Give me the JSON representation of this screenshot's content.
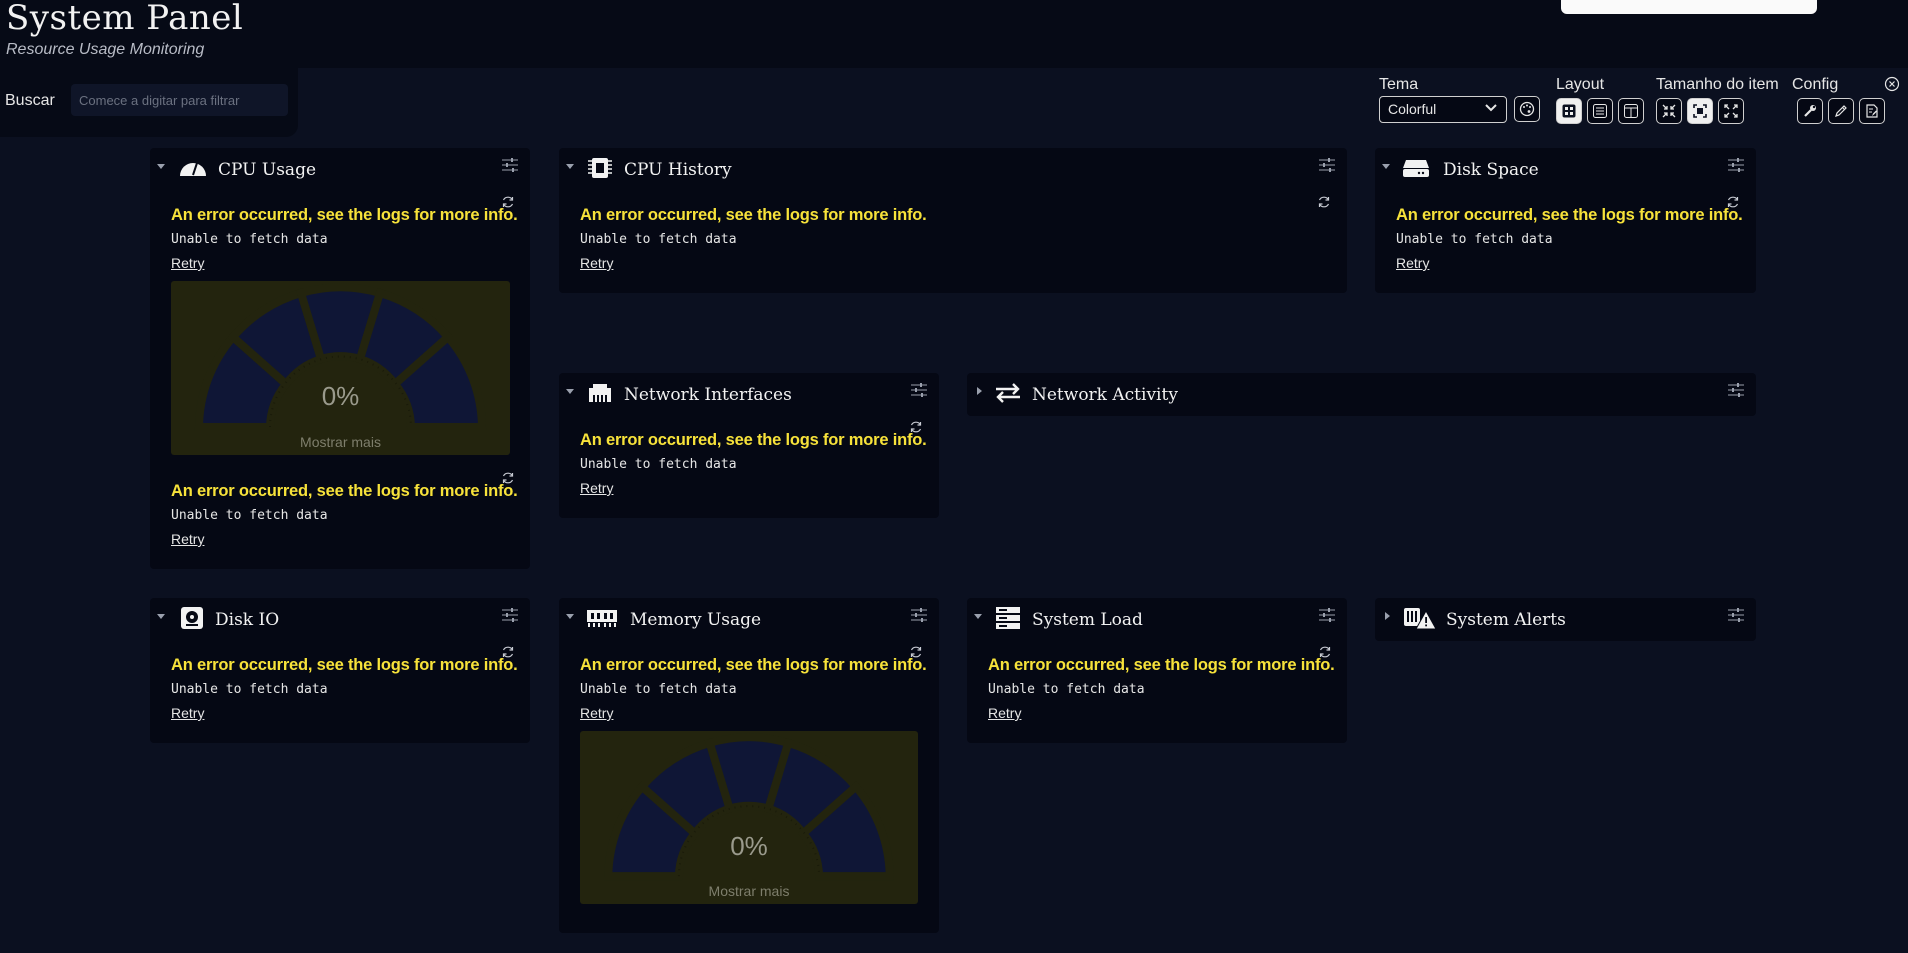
{
  "header": {
    "title": "System Panel",
    "subtitle": "Resource Usage Monitoring"
  },
  "search": {
    "label": "Buscar",
    "placeholder": "Comece a digitar para filtrar"
  },
  "settings": {
    "theme_label": "Tema",
    "theme_value": "Colorful",
    "layout_label": "Layout",
    "item_size_label": "Tamanho do item",
    "config_label": "Config"
  },
  "error": {
    "title": "An error occurred, see the logs for more info.",
    "message": "Unable to fetch data",
    "retry": "Retry"
  },
  "gauge": {
    "value": "0%",
    "more": "Mostrar mais"
  },
  "cards": {
    "cpu_usage": {
      "title": "CPU Usage",
      "icon": "gauge-icon"
    },
    "cpu_history": {
      "title": "CPU History",
      "icon": "cpu-chip-icon"
    },
    "disk_space": {
      "title": "Disk Space",
      "icon": "hard-drive-icon"
    },
    "network_interfaces": {
      "title": "Network Interfaces",
      "icon": "ethernet-icon"
    },
    "network_activity": {
      "title": "Network Activity",
      "icon": "arrows-exchange-icon"
    },
    "disk_io": {
      "title": "Disk IO",
      "icon": "hdd-disc-icon"
    },
    "memory_usage": {
      "title": "Memory Usage",
      "icon": "memory-icon"
    },
    "system_load": {
      "title": "System Load",
      "icon": "server-icon"
    },
    "system_alerts": {
      "title": "System Alerts",
      "icon": "alert-icon"
    }
  },
  "colors": {
    "background": "#0b1020",
    "card": "#050814",
    "error": "#f7e23a",
    "gauge_bg": "#23240e"
  }
}
